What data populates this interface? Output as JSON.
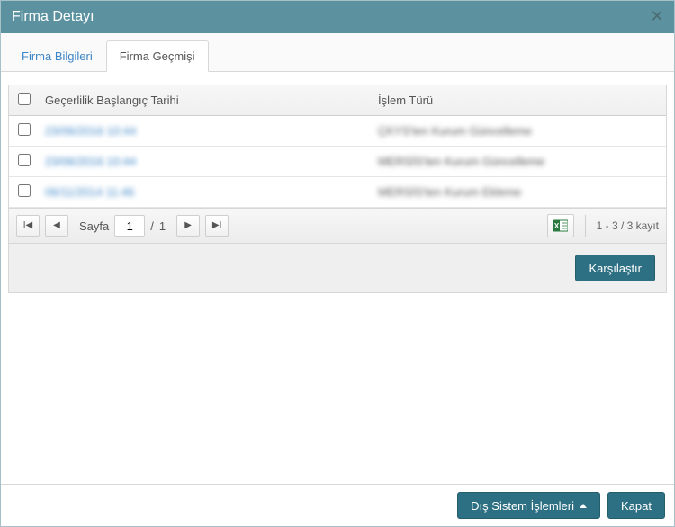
{
  "dialog": {
    "title": "Firma Detayı"
  },
  "tabs": [
    {
      "label": "Firma Bilgileri",
      "active": false
    },
    {
      "label": "Firma Geçmişi",
      "active": true
    }
  ],
  "grid": {
    "columns": {
      "date": "Geçerlilik Başlangıç Tarihi",
      "type": "İşlem Türü"
    },
    "rows": [
      {
        "date": "23/06/2016 10:44",
        "type": "ÇKYS'ten Kurum Güncelleme"
      },
      {
        "date": "23/06/2016 10:44",
        "type": "MERSİS'ten Kurum Güncelleme"
      },
      {
        "date": "06/11/2014 11:46",
        "type": "MERSİS'ten Kurum Ekleme"
      }
    ]
  },
  "pager": {
    "label": "Sayfa",
    "page": "1",
    "total_sep": "/",
    "total": "1",
    "record_text": "1 - 3 / 3 kayıt"
  },
  "actions": {
    "compare": "Karşılaştır",
    "external": "Dış Sistem İşlemleri",
    "close": "Kapat"
  }
}
